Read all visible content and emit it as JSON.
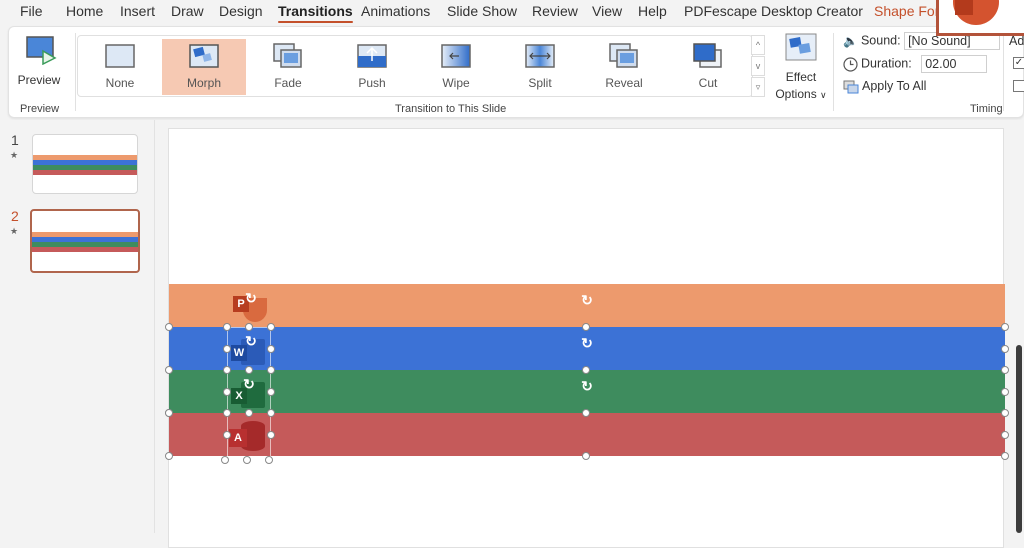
{
  "menubar": {
    "items": [
      "File",
      "Home",
      "Insert",
      "Draw",
      "Design",
      "Transitions",
      "Animations",
      "Slide Show",
      "Review",
      "View",
      "Help",
      "PDFescape Desktop Creator",
      "Shape Format"
    ],
    "active": "Transitions",
    "contextual": "Shape Format"
  },
  "ribbon": {
    "preview_group": {
      "button_label": "Preview",
      "group_label": "Preview"
    },
    "transitions_group": {
      "group_label": "Transition to This Slide",
      "items": [
        {
          "label": "None",
          "icon": "none-transition-icon",
          "selected": false
        },
        {
          "label": "Morph",
          "icon": "morph-transition-icon",
          "selected": true
        },
        {
          "label": "Fade",
          "icon": "fade-transition-icon",
          "selected": false
        },
        {
          "label": "Push",
          "icon": "push-transition-icon",
          "selected": false
        },
        {
          "label": "Wipe",
          "icon": "wipe-transition-icon",
          "selected": false
        },
        {
          "label": "Split",
          "icon": "split-transition-icon",
          "selected": false
        },
        {
          "label": "Reveal",
          "icon": "reveal-transition-icon",
          "selected": false
        },
        {
          "label": "Cut",
          "icon": "cut-transition-icon",
          "selected": false
        }
      ],
      "effect_options_label_1": "Effect",
      "effect_options_label_2": "Options",
      "scroll_up": "^",
      "scroll_down": "v",
      "more": "▿"
    },
    "timing_group": {
      "group_label": "Timing",
      "sound_label": "Sound:",
      "sound_value": "[No Sound]",
      "duration_label": "Duration:",
      "duration_value": "02.00",
      "apply_all_label": "Apply To All",
      "advance_label_partial": "Ad",
      "checkbox_on_click": true,
      "checkbox_after": false
    }
  },
  "slides_panel": {
    "slides": [
      {
        "number": "1",
        "active": false
      },
      {
        "number": "2",
        "active": true
      }
    ]
  },
  "slide": {
    "bands": [
      {
        "name": "powerpoint-band",
        "color": "#ed9a6d",
        "icon_letter": "P",
        "icon_color": "#c94a2b"
      },
      {
        "name": "word-band",
        "color": "#3c72d6",
        "icon_letter": "W",
        "icon_color": "#2b5bb8"
      },
      {
        "name": "excel-band",
        "color": "#3e8c5e",
        "icon_letter": "X",
        "icon_color": "#1f6b3e"
      },
      {
        "name": "access-band",
        "color": "#c55a5a",
        "icon_letter": "A",
        "icon_color": "#b02f2f"
      }
    ]
  },
  "colors": {
    "accent": "#c4502b",
    "selected_transition": "#f6c9b3"
  }
}
